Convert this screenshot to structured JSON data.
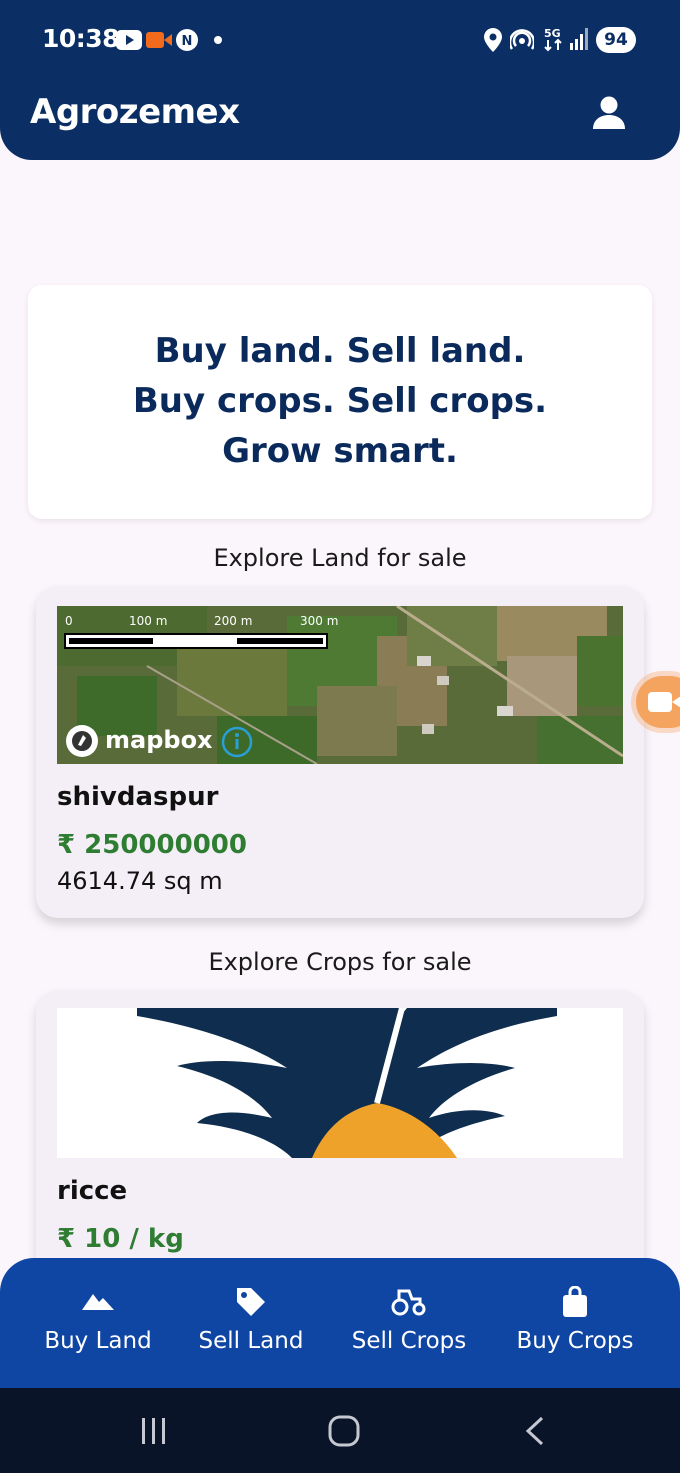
{
  "status_bar": {
    "time": "10:38",
    "battery": "94"
  },
  "app": {
    "title": "Agrozemex"
  },
  "hero": {
    "line1": "Buy land. Sell land.",
    "line2": "Buy crops. Sell crops.",
    "line3": "Grow smart."
  },
  "land_section": {
    "title": "Explore Land for sale",
    "card": {
      "name": "shivdaspur",
      "price": "₹ 250000000",
      "area": "4614.74 sq m",
      "map": {
        "scale_labels": [
          "0",
          "100 m",
          "200 m",
          "300 m"
        ],
        "attribution": "mapbox"
      }
    }
  },
  "crops_section": {
    "title": "Explore Crops for sale",
    "card": {
      "name": "ricce",
      "price": "₹ 10 / kg"
    }
  },
  "bottom_nav": [
    {
      "label": "Buy Land",
      "icon": "mountain-icon"
    },
    {
      "label": "Sell Land",
      "icon": "tag-icon"
    },
    {
      "label": "Sell Crops",
      "icon": "tractor-icon"
    },
    {
      "label": "Buy Crops",
      "icon": "shopping-bag-icon"
    }
  ],
  "colors": {
    "primary": "#0b2f64",
    "nav": "#0f46a3",
    "price": "#2e7d32",
    "fab": "#f5a45f"
  }
}
